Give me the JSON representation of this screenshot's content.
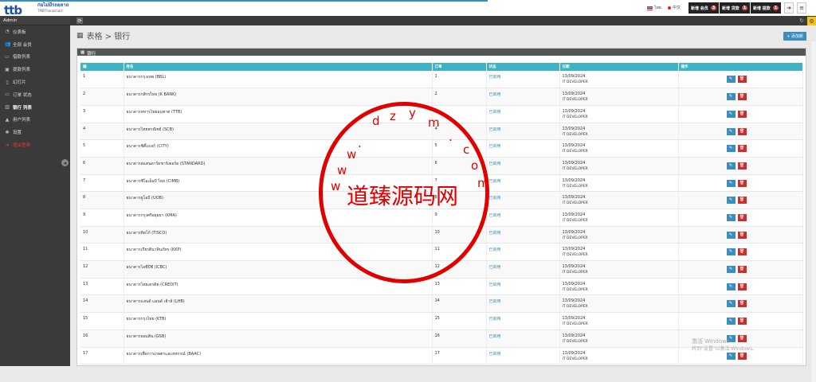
{
  "brand": {
    "logo_text": "ttb",
    "line1": "ก่อไม่มีรถยลาถ",
    "line2": "TMBThanachart"
  },
  "lang": {
    "thai": "ไทย",
    "chinese": "中文"
  },
  "nav_buttons": [
    {
      "label": "新增 会员",
      "badge": "3"
    },
    {
      "label": "新增 贷款",
      "badge": "1"
    },
    {
      "label": "新增 提款",
      "badge": "1"
    }
  ],
  "sidebar": {
    "head": "Admin",
    "items": [
      {
        "label": "仪表板",
        "icon": "dashboard-icon",
        "glyph": "◔"
      },
      {
        "label": "全部 会员",
        "icon": "users-icon",
        "glyph": "👥"
      },
      {
        "label": "借款列表",
        "icon": "loan-list-icon",
        "glyph": "▭"
      },
      {
        "label": "提款列表",
        "icon": "withdraw-list-icon",
        "glyph": "▣"
      },
      {
        "label": "幻灯片",
        "icon": "slides-icon",
        "glyph": "▯"
      },
      {
        "label": "订单 状态",
        "icon": "order-status-icon",
        "glyph": "▭"
      },
      {
        "label": "银行 列表",
        "icon": "bank-icon",
        "glyph": "▥"
      },
      {
        "label": "用户列表",
        "icon": "user-icon",
        "glyph": "▲"
      },
      {
        "label": "设置",
        "icon": "settings-icon",
        "glyph": "✱"
      },
      {
        "label": "退出登录",
        "icon": "logout-icon",
        "glyph": "➜"
      }
    ]
  },
  "page": {
    "title": "表格 > 银行",
    "add_button": "+ 添加新",
    "panel_title": "银行"
  },
  "table": {
    "columns": [
      "编",
      "姓名",
      "订单",
      "状态",
      "日期",
      "操作"
    ],
    "rows": [
      {
        "id": "1",
        "name": "ธนาคารกรุงเทพ (BBL)",
        "order": "1",
        "status": "已启用",
        "date": "13/09/2024",
        "by": "IT DEVELOPER"
      },
      {
        "id": "2",
        "name": "ธนาคารกสิกรไทย (K BANK)",
        "order": "2",
        "status": "已启用",
        "date": "13/09/2024",
        "by": "IT DEVELOPER"
      },
      {
        "id": "3",
        "name": "ธนาคารทหารไทยธนชาต (TTB)",
        "order": "3",
        "status": "已启用",
        "date": "13/09/2024",
        "by": "IT DEVELOPER"
      },
      {
        "id": "4",
        "name": "ธนาคารไทยพาณิชย์ (SCB)",
        "order": "4",
        "status": "已启用",
        "date": "13/09/2024",
        "by": "IT DEVELOPER"
      },
      {
        "id": "5",
        "name": "ธนาคารซิตี้แบงก์ (CITY)",
        "order": "5",
        "status": "已启用",
        "date": "13/09/2024",
        "by": "IT DEVELOPER"
      },
      {
        "id": "6",
        "name": "ธนาคารสแตนดาร์ดชาร์เตอร์ด (STANDARD)",
        "order": "6",
        "status": "已启用",
        "date": "13/09/2024",
        "by": "IT DEVELOPER"
      },
      {
        "id": "7",
        "name": "ธนาคารซีไอเอ็มบี ไทย (CIMB)",
        "order": "7",
        "status": "已启用",
        "date": "13/09/2024",
        "by": "IT DEVELOPER"
      },
      {
        "id": "8",
        "name": "ธนาคารยูโอบี (UOB)",
        "order": "8",
        "status": "已启用",
        "date": "13/09/2024",
        "by": "IT DEVELOPER"
      },
      {
        "id": "9",
        "name": "ธนาคารกรุงศรีอยุธยา (KMA)",
        "order": "9",
        "status": "已启用",
        "date": "13/09/2024",
        "by": "IT DEVELOPER"
      },
      {
        "id": "10",
        "name": "ธนาคารทิสโก้ (TISCO)",
        "order": "10",
        "status": "已启用",
        "date": "13/09/2024",
        "by": "IT DEVELOPER"
      },
      {
        "id": "11",
        "name": "ธนาคารเกียรตินาคินภัทร (KKP)",
        "order": "11",
        "status": "已启用",
        "date": "13/09/2024",
        "by": "IT DEVELOPER"
      },
      {
        "id": "12",
        "name": "ธนาคารไอซีบีซี (ICBC)",
        "order": "12",
        "status": "已启用",
        "date": "13/09/2024",
        "by": "IT DEVELOPER"
      },
      {
        "id": "13",
        "name": "ธนาคารไทยเครดิต (CREDIT)",
        "order": "13",
        "status": "已启用",
        "date": "13/09/2024",
        "by": "IT DEVELOPER"
      },
      {
        "id": "14",
        "name": "ธนาคารแลนด์ แอนด์ เฮ้าส์ (LHB)",
        "order": "14",
        "status": "已启用",
        "date": "13/09/2024",
        "by": "IT DEVELOPER"
      },
      {
        "id": "15",
        "name": "ธนาคารกรุงไทย (KTB)",
        "order": "15",
        "status": "已启用",
        "date": "13/09/2024",
        "by": "IT DEVELOPER"
      },
      {
        "id": "16",
        "name": "ธนาคารออมสิน (GSB)",
        "order": "16",
        "status": "已启用",
        "date": "13/09/2024",
        "by": "IT DEVELOPER"
      },
      {
        "id": "17",
        "name": "ธนาคารเพื่อการเกษตรและสหกรณ์ (BAAC)",
        "order": "17",
        "status": "已启用",
        "date": "13/09/2024",
        "by": "IT DEVELOPER"
      }
    ]
  },
  "watermark": {
    "center": "道臻源码网",
    "top_chars": [
      "w",
      "w",
      "w",
      ".",
      "d",
      "z",
      "y",
      "m",
      ".",
      "c",
      "o",
      "m"
    ]
  },
  "windows_activation": {
    "line1": "激活 Windows",
    "line2": "转到\"设置\"以激活 Windows。"
  },
  "colors": {
    "accent": "#3c8dbc",
    "header_teal": "#3eb3c5",
    "danger": "#c9302c",
    "watermark": "#e00000"
  }
}
